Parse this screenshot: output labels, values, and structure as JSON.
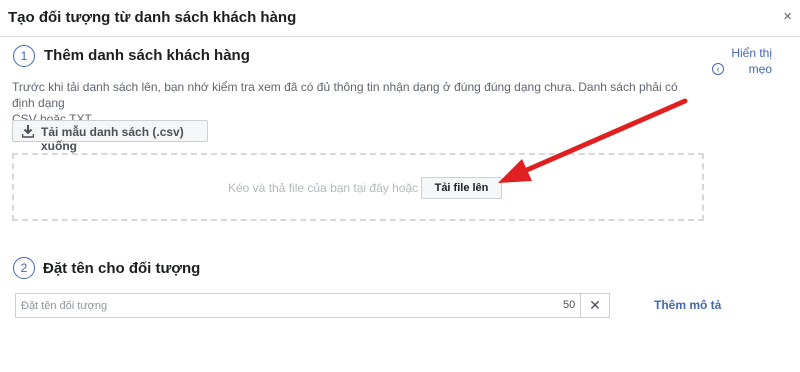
{
  "dialog": {
    "title": "Tạo đối tượng từ danh sách khách hàng",
    "close_glyph": "×"
  },
  "step1": {
    "number": "1",
    "title": "Thêm danh sách khách hàng",
    "description_line1": "Trước khi tải danh sách lên, bạn nhớ kiểm tra xem đã có đủ thông tin nhận dạng ở đúng đúng dạng chưa. Danh sách phải có định dạng",
    "description_line2": "CSV hoặc TXT.",
    "download_label": "Tải mẫu danh sách (.csv) xuống",
    "drop_text": "Kéo và thả file của bạn tại đây hoặc",
    "upload_label": "Tải file lên",
    "tips_line1": "Hiển thị",
    "tips_line2": "mẹo"
  },
  "step2": {
    "number": "2",
    "title": "Đặt tên cho đối tượng",
    "name_placeholder": "Đặt tên đối tượng",
    "char_count": "50",
    "clear_glyph": "✕",
    "add_description": "Thêm mô tả"
  },
  "colors": {
    "accent": "#4267b2",
    "arrow": "#e02020"
  },
  "icons": {
    "download": "download-icon",
    "close": "close-icon",
    "chevron": "chevron-left-icon",
    "arrow": "red-arrow-annotation"
  }
}
